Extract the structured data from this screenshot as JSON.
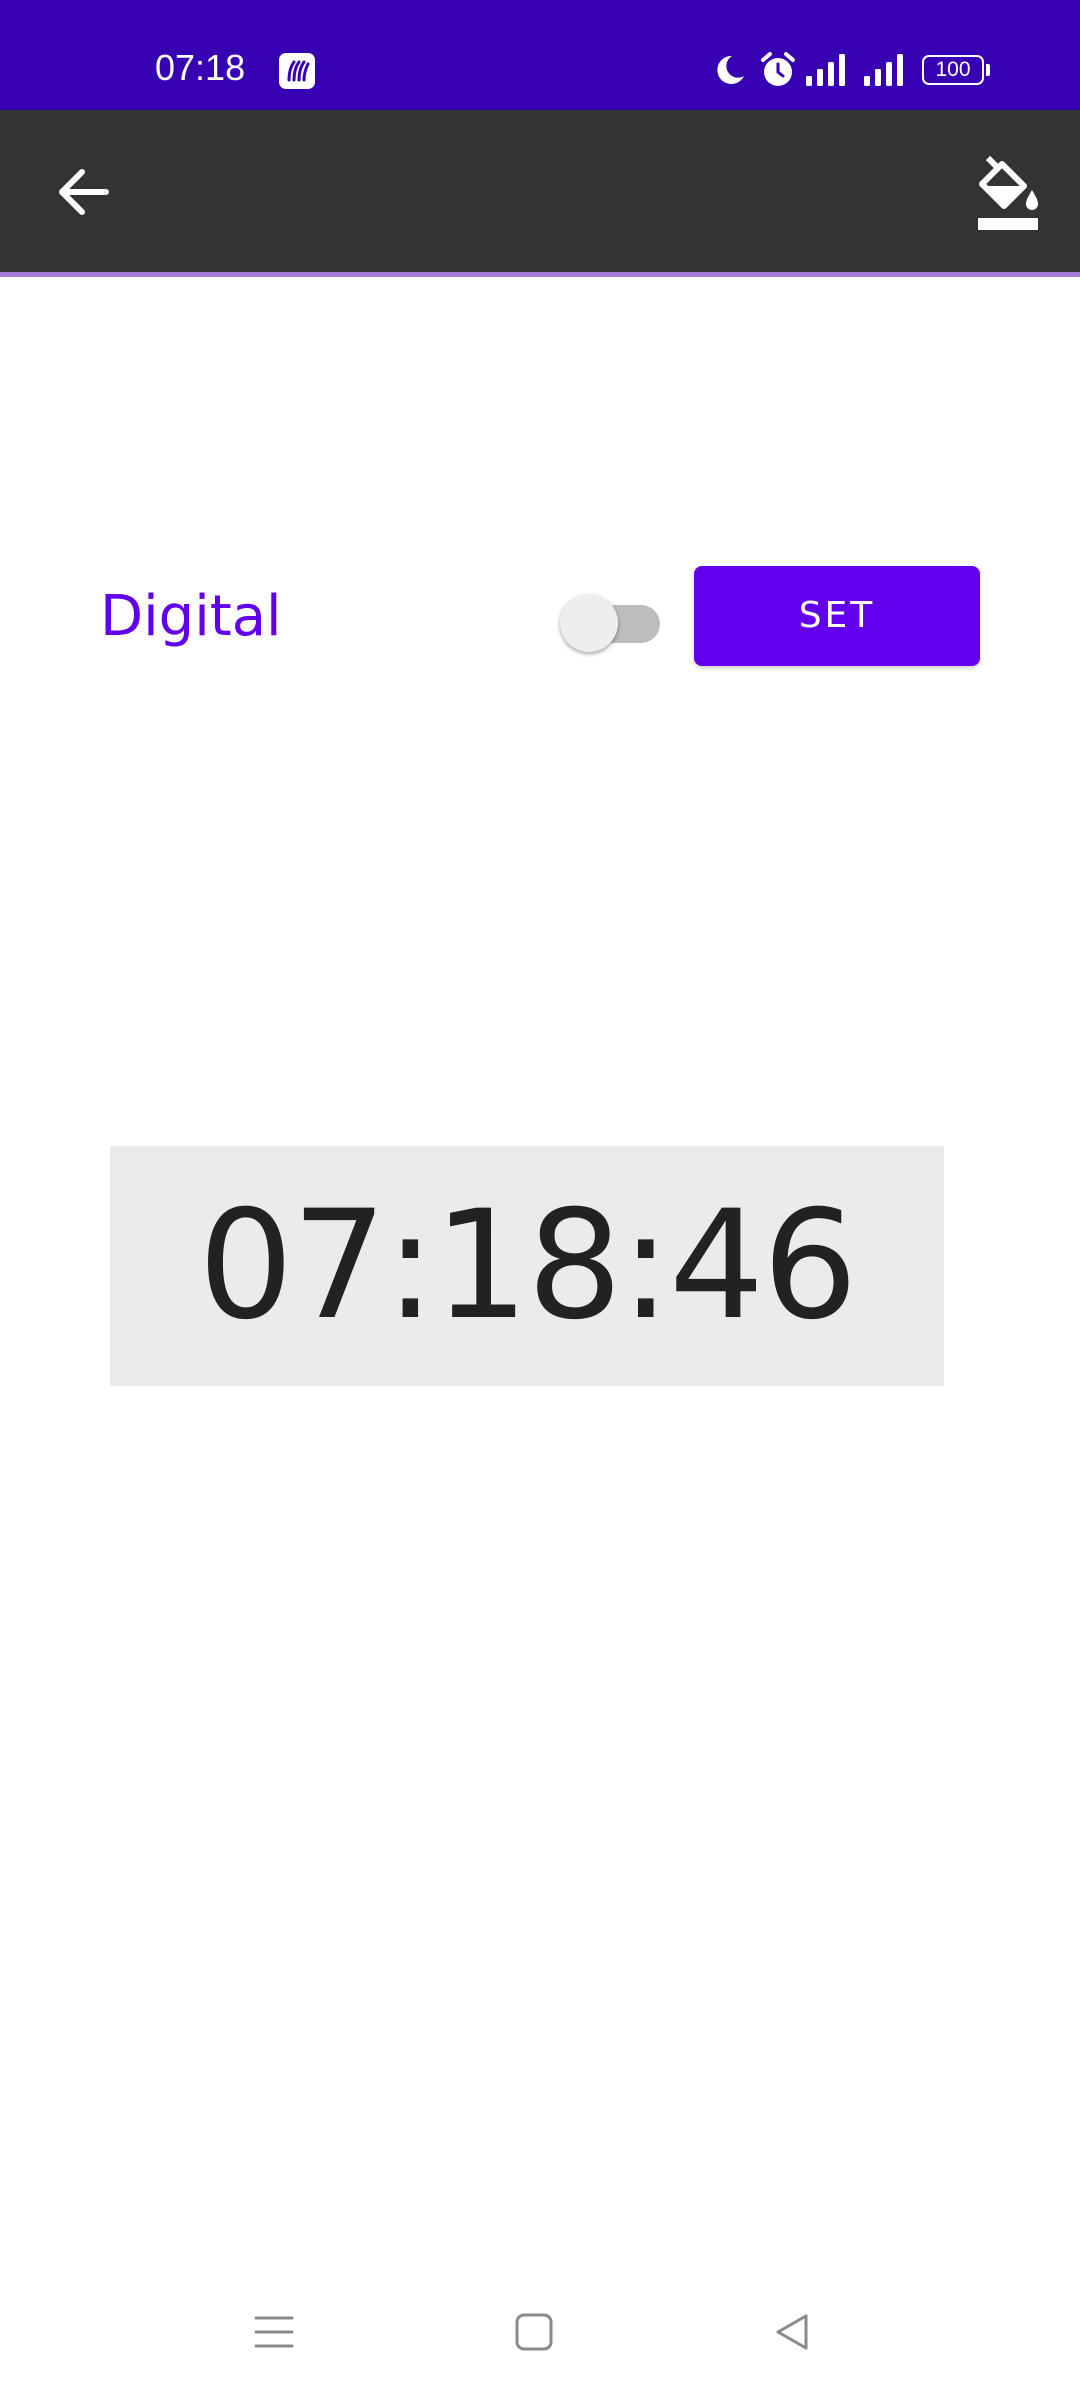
{
  "status_bar": {
    "time": "07:18",
    "battery_level": "100",
    "icons": [
      "notification-app-icon",
      "do-not-disturb-moon-icon",
      "alarm-icon",
      "signal-strength-icon-1",
      "signal-strength-icon-2",
      "battery-icon"
    ],
    "background_color": "#3700b3"
  },
  "app_bar": {
    "icons": [
      "back-arrow-icon",
      "paint-bucket-icon"
    ],
    "background_color": "#333333"
  },
  "controls": {
    "mode_label": "Digital",
    "toggle_state": "off",
    "set_button_label": "SET",
    "accent_color": "#6200ee"
  },
  "clock": {
    "time": "07:18:46"
  },
  "nav_bar": {
    "icons": [
      "menu-lines-icon",
      "home-square-icon",
      "back-triangle-icon"
    ]
  }
}
